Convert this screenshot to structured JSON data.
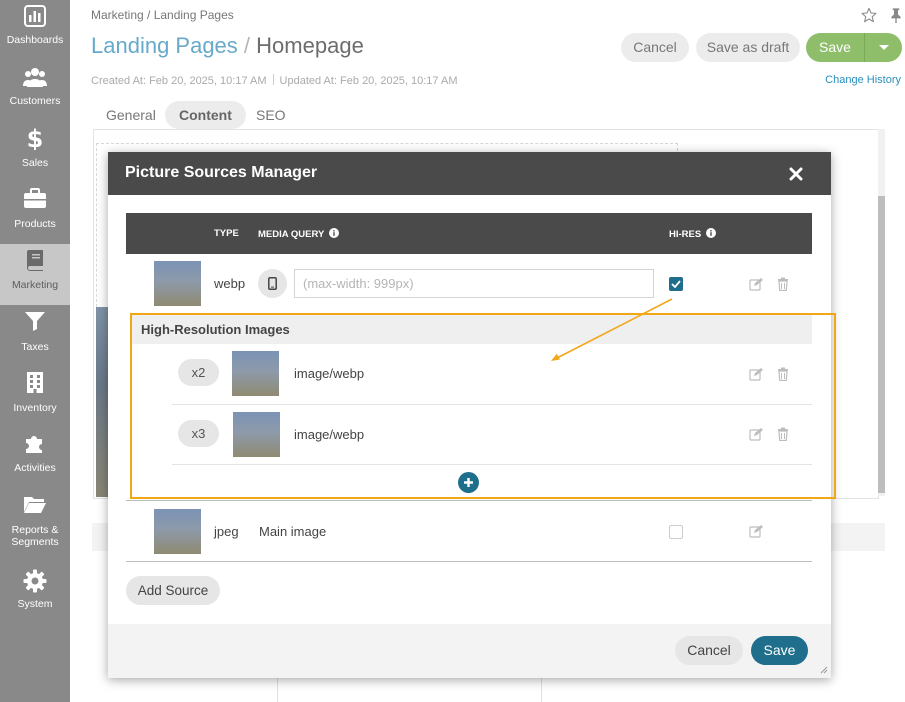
{
  "sidebar": {
    "items": [
      {
        "label": "Dashboards",
        "icon": "bar-chart-icon"
      },
      {
        "label": "Customers",
        "icon": "users-icon"
      },
      {
        "label": "Sales",
        "icon": "dollar-icon"
      },
      {
        "label": "Products",
        "icon": "briefcase-icon"
      },
      {
        "label": "Marketing",
        "icon": "book-icon",
        "active": true
      },
      {
        "label": "Taxes",
        "icon": "funnel-icon"
      },
      {
        "label": "Inventory",
        "icon": "building-icon"
      },
      {
        "label": "Activities",
        "icon": "puzzle-icon"
      },
      {
        "label": "Reports &",
        "label2": "Segments",
        "icon": "folder-open-icon"
      },
      {
        "label": "System",
        "icon": "gear-icon"
      }
    ]
  },
  "header": {
    "breadcrumb": "Marketing / Landing Pages",
    "title": "Landing Pages",
    "title_sep": "/",
    "subtitle": "Homepage",
    "created": "Created At: Feb 20, 2025, 10:17 AM",
    "updated": "Updated At: Feb 20, 2025, 10:17 AM",
    "change_history": "Change History",
    "cancel": "Cancel",
    "save_draft": "Save as draft",
    "save": "Save"
  },
  "tabs": [
    "General",
    "Content",
    "SEO"
  ],
  "modal": {
    "title": "Picture Sources Manager",
    "columns": {
      "type": "TYPE",
      "media_query": "MEDIA QUERY",
      "hires": "HI-RES"
    },
    "source1": {
      "type": "webp",
      "media_placeholder": "(max-width: 999px)",
      "hires_checked": true
    },
    "hires_section": {
      "title": "High-Resolution Images",
      "rows": [
        {
          "multiplier": "x2",
          "mime": "image/webp"
        },
        {
          "multiplier": "x3",
          "mime": "image/webp"
        }
      ]
    },
    "source2": {
      "type": "jpeg",
      "label": "Main image",
      "hires_checked": false
    },
    "add_source": "Add Source",
    "cancel": "Cancel",
    "save": "Save"
  },
  "colors": {
    "accent": "#1f6e8c",
    "save_green": "#8fbe6a",
    "highlight": "#f0a819",
    "sidebar_bg": "#898989"
  }
}
